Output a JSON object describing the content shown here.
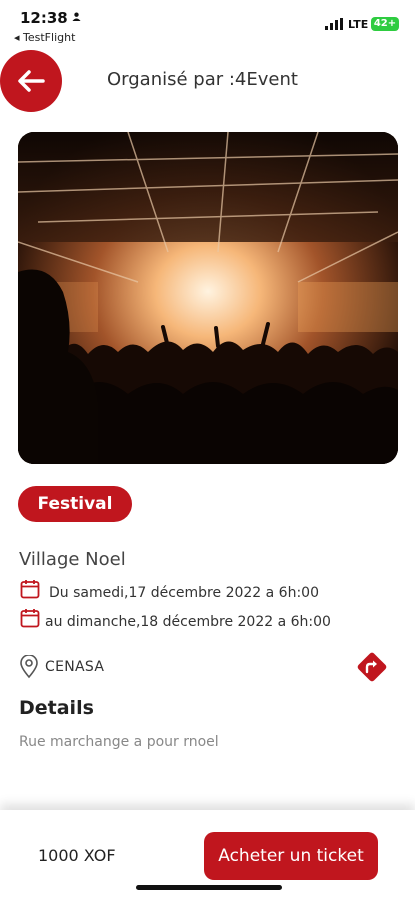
{
  "status_bar": {
    "time": "12:38",
    "back_app": "◂ TestFlight",
    "network": "LTE",
    "battery": "42+"
  },
  "header": {
    "title": "Organisé par :4Event",
    "back_icon": "arrow-left-icon"
  },
  "event": {
    "image_alt": "concert-crowd-image",
    "category": "Festival",
    "title": "Village Noel",
    "start_date": "Du samedi,17 décembre 2022 a 6h:00",
    "end_date": "au dimanche,18 décembre 2022 a 6h:00",
    "location": "CENASA",
    "details_heading": "Details",
    "details_text": "Rue marchange a pour rnoel"
  },
  "footer": {
    "price": "1000 XOF",
    "buy_label": "Acheter un ticket"
  },
  "colors": {
    "accent": "#c0161e",
    "battery": "#2ecc40"
  }
}
